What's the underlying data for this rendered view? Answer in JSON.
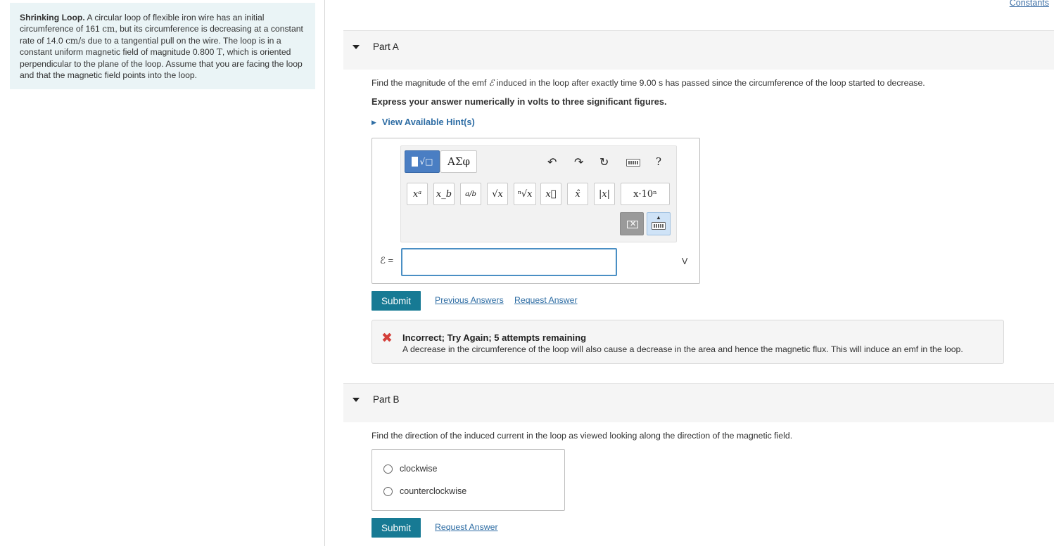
{
  "problem": {
    "title": "Shrinking Loop.",
    "text_1": "A circular loop of flexible iron wire has an initial circumference of 161",
    "unit_cm": "cm",
    "text_2": ", but its circumference is decreasing at a constant rate of 14.0",
    "unit_cm_s": "cm/s",
    "text_3": "due to a tangential pull on the wire. The loop is in a constant uniform magnetic field of magnitude 0.800",
    "unit_T": "T",
    "text_4": ", which is oriented perpendicular to the plane of the loop. Assume that you are facing the loop and that the magnetic field points into the loop."
  },
  "constants_link": "Constants",
  "part_a": {
    "title": "Part A",
    "question_pre": "Find the magnitude of the emf",
    "emf_symbol": "ℰ",
    "question_post": "induced in the loop after exactly time 9.00 s has passed since the circumference of the loop started to decrease.",
    "instruction": "Express your answer numerically in volts to three significant figures.",
    "hints_label": "View Available Hint(s)",
    "toolbar": {
      "greek": "ΑΣφ",
      "help": "?",
      "symbols": [
        "xᵃ",
        "x_b",
        "a/b",
        "√x",
        "ⁿ√x",
        "x⃗",
        "x̂",
        "|x|",
        "x·10ⁿ"
      ]
    },
    "answer_label": "ℰ =",
    "answer_value": "",
    "unit": "V",
    "submit": "Submit",
    "previous_answers": "Previous Answers",
    "request_answer": "Request Answer",
    "feedback": {
      "title": "Incorrect; Try Again; 5 attempts remaining",
      "message": "A decrease in the circumference of the loop will also cause a decrease in the area and hence the magnetic flux. This will induce an emf in the loop."
    }
  },
  "part_b": {
    "title": "Part B",
    "question": "Find the direction of the induced current in the loop as viewed looking along the direction of the magnetic field.",
    "options": [
      "clockwise",
      "counterclockwise"
    ],
    "submit": "Submit",
    "request_answer": "Request Answer"
  },
  "colors": {
    "problem_bg": "#eaf4f6",
    "submit_bg": "#177a94",
    "link": "#2e6da4",
    "error": "#d43f3a"
  }
}
